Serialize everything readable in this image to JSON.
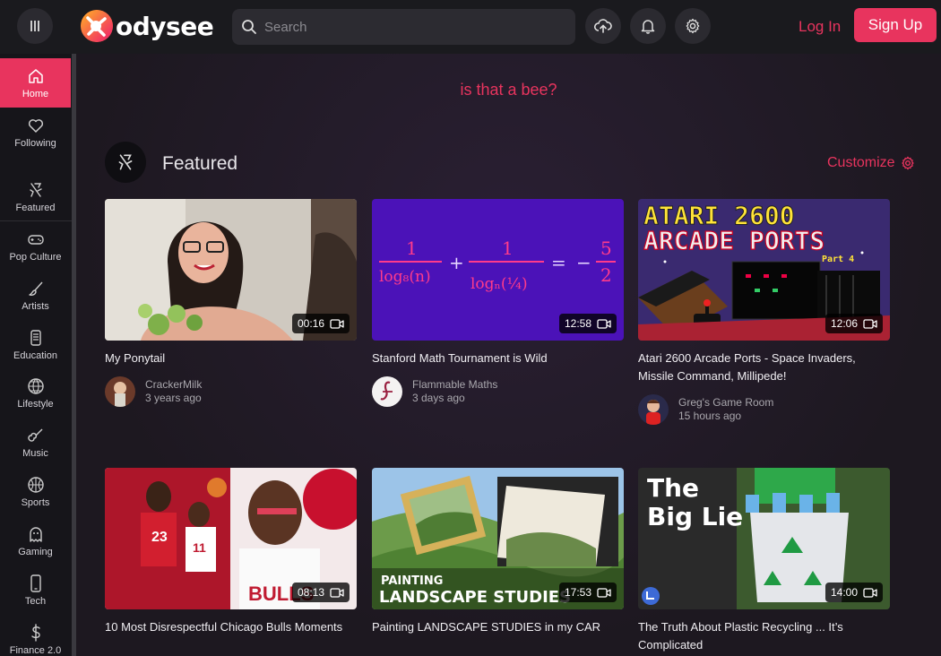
{
  "header": {
    "logo_text": "odysee",
    "search_placeholder": "Search",
    "login_label": "Log In",
    "signup_label": "Sign Up",
    "icons": [
      "menu-icon",
      "upload-icon",
      "bell-icon",
      "gear-icon"
    ]
  },
  "sidebar": {
    "items": [
      {
        "label": "Home",
        "icon": "home-icon",
        "active": true
      },
      {
        "label": "Following",
        "icon": "heart-icon"
      },
      {
        "label": "Featured",
        "icon": "featured-icon"
      },
      {
        "label": "Pop Culture",
        "icon": "gamepad-icon"
      },
      {
        "label": "Artists",
        "icon": "brush-icon"
      },
      {
        "label": "Education",
        "icon": "book-icon"
      },
      {
        "label": "Lifestyle",
        "icon": "globe-icon"
      },
      {
        "label": "Music",
        "icon": "guitar-icon"
      },
      {
        "label": "Sports",
        "icon": "basketball-icon"
      },
      {
        "label": "Gaming",
        "icon": "ghost-icon"
      },
      {
        "label": "Tech",
        "icon": "phone-icon"
      },
      {
        "label": "Finance 2.0",
        "icon": "dollar-icon"
      }
    ]
  },
  "main": {
    "banner": "is that a bee?",
    "section_title": "Featured",
    "customize_label": "Customize",
    "videos": [
      {
        "title": "My Ponytail",
        "duration": "00:16",
        "channel": "CrackerMilk",
        "age": "3 years ago"
      },
      {
        "title": "Stanford Math Tournament is Wild",
        "duration": "12:58",
        "channel": "Flammable Maths",
        "age": "3 days ago"
      },
      {
        "title": "Atari 2600 Arcade Ports - Space Invaders, Missile Command, Millipede!",
        "duration": "12:06",
        "channel": "Greg's Game Room",
        "age": "15 hours ago"
      },
      {
        "title": "10 Most Disrespectful Chicago Bulls Moments",
        "duration": "08:13"
      },
      {
        "title": "Painting LANDSCAPE STUDIES in my CAR",
        "duration": "17:53"
      },
      {
        "title": "The Truth About Plastic Recycling ... It’s Complicated",
        "duration": "14:00"
      }
    ],
    "thumb_text": {
      "atari_line1": "ATARI 2600",
      "atari_line2": "ARCADE PORTS",
      "atari_part": "Part 4",
      "painting_small": "PAINTING",
      "painting_big": "LANDSCAPE STUDIES",
      "biglie_line1": "The",
      "biglie_line2": "Big Lie"
    }
  },
  "colors": {
    "accent": "#e8345e",
    "header_bg": "#1a1a1e",
    "sidebar_bg": "#16151a"
  }
}
